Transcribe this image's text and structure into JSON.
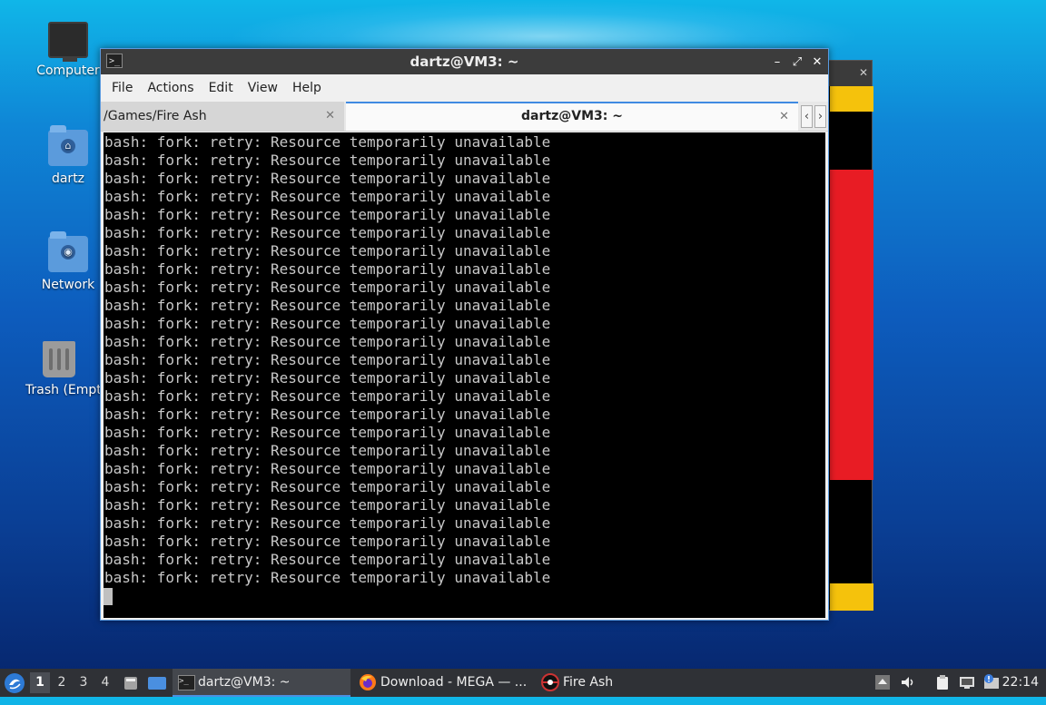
{
  "desktop": {
    "icons": [
      {
        "label": "Computer",
        "icon": "computer-icon"
      },
      {
        "label": "dartz",
        "icon": "home-folder-icon"
      },
      {
        "label": "Network",
        "icon": "network-folder-icon"
      },
      {
        "label": "Trash (Empty",
        "icon": "trash-icon"
      }
    ]
  },
  "terminal": {
    "title": "dartz@VM3: ~",
    "controls": {
      "minimize": "–",
      "maximize": "⤢",
      "close": "✕"
    },
    "menu": [
      "File",
      "Actions",
      "Edit",
      "View",
      "Help"
    ],
    "tabs": [
      {
        "label": "/Games/Fire Ash",
        "active": false,
        "close": "✕"
      },
      {
        "label": "dartz@VM3: ~",
        "active": true,
        "close": "✕"
      }
    ],
    "tab_nav": {
      "left": "‹",
      "right": "›"
    },
    "lines": [
      "bash: fork: retry: Resource temporarily unavailable",
      "bash: fork: retry: Resource temporarily unavailable",
      "bash: fork: retry: Resource temporarily unavailable",
      "bash: fork: retry: Resource temporarily unavailable",
      "bash: fork: retry: Resource temporarily unavailable",
      "bash: fork: retry: Resource temporarily unavailable",
      "bash: fork: retry: Resource temporarily unavailable",
      "bash: fork: retry: Resource temporarily unavailable",
      "bash: fork: retry: Resource temporarily unavailable",
      "bash: fork: retry: Resource temporarily unavailable",
      "bash: fork: retry: Resource temporarily unavailable",
      "bash: fork: retry: Resource temporarily unavailable",
      "bash: fork: retry: Resource temporarily unavailable",
      "bash: fork: retry: Resource temporarily unavailable",
      "bash: fork: retry: Resource temporarily unavailable",
      "bash: fork: retry: Resource temporarily unavailable",
      "bash: fork: retry: Resource temporarily unavailable",
      "bash: fork: retry: Resource temporarily unavailable",
      "bash: fork: retry: Resource temporarily unavailable",
      "bash: fork: retry: Resource temporarily unavailable",
      "bash: fork: retry: Resource temporarily unavailable",
      "bash: fork: retry: Resource temporarily unavailable",
      "bash: fork: retry: Resource temporarily unavailable",
      "bash: fork: retry: Resource temporarily unavailable",
      "bash: fork: retry: Resource temporarily unavailable"
    ]
  },
  "taskbar": {
    "workspaces": [
      "1",
      "2",
      "3",
      "4"
    ],
    "active_workspace": "1",
    "tasks": [
      {
        "label": "dartz@VM3: ~",
        "icon": "terminal-icon",
        "active": true
      },
      {
        "label": "Download - MEGA — ...",
        "icon": "firefox-icon",
        "active": false
      },
      {
        "label": "Fire Ash",
        "icon": "game-icon",
        "active": false
      }
    ],
    "clock": "22:14"
  },
  "colors": {
    "accent": "#4a90e2",
    "terminal_bg": "#000000",
    "terminal_fg": "#c8c8c8",
    "fire_ash_yellow": "#f5c20c",
    "fire_ash_red": "#e81c24"
  }
}
